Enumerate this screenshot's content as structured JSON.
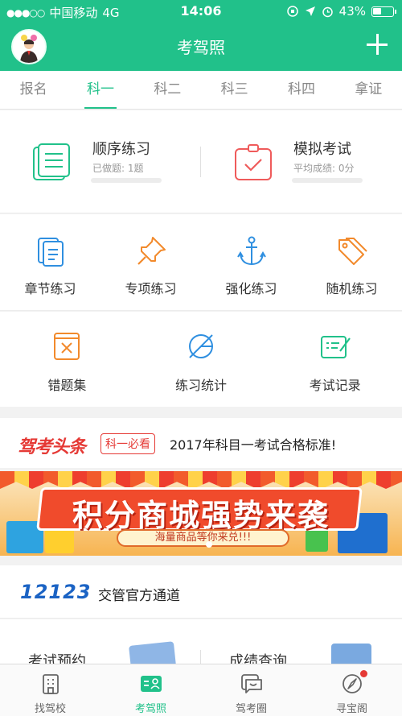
{
  "status": {
    "carrier": "中国移动",
    "network": "4G",
    "time": "14:06",
    "battery": "43%"
  },
  "header": {
    "title": "考驾照"
  },
  "tabs": [
    {
      "label": "报名"
    },
    {
      "label": "科一"
    },
    {
      "label": "科二"
    },
    {
      "label": "科三"
    },
    {
      "label": "科四"
    },
    {
      "label": "拿证"
    }
  ],
  "practice": {
    "sequential": {
      "title": "顺序练习",
      "sub": "已做题: 1题"
    },
    "mock": {
      "title": "模拟考试",
      "sub": "平均成绩: 0分"
    }
  },
  "grid4": [
    {
      "label": "章节练习",
      "icon": "document-stack-icon"
    },
    {
      "label": "专项练习",
      "icon": "pushpin-icon"
    },
    {
      "label": "强化练习",
      "icon": "anchor-icon"
    },
    {
      "label": "随机练习",
      "icon": "tags-icon"
    }
  ],
  "grid3": [
    {
      "label": "错题集",
      "icon": "wrong-book-icon"
    },
    {
      "label": "练习统计",
      "icon": "statistics-icon"
    },
    {
      "label": "考试记录",
      "icon": "exam-record-icon"
    }
  ],
  "headline": {
    "logo": "驾考头条",
    "badge": "科一必看",
    "text": "2017年科目一考试合格标准!"
  },
  "banner": {
    "title": "积分商城强势来袭",
    "subtitle": "海量商品等你来兑!!!"
  },
  "gov": {
    "logo": "12123",
    "text": "交管官方通道"
  },
  "services": {
    "left": "考试预约",
    "right": "成绩查询"
  },
  "bottomnav": [
    {
      "label": "找驾校",
      "icon": "building-icon"
    },
    {
      "label": "考驾照",
      "icon": "license-icon"
    },
    {
      "label": "驾考圈",
      "icon": "chat-icon"
    },
    {
      "label": "寻宝阁",
      "icon": "compass-icon"
    }
  ],
  "colors": {
    "brand": "#21c18a",
    "accent_red": "#e53935",
    "gov_blue": "#1b63c4"
  }
}
